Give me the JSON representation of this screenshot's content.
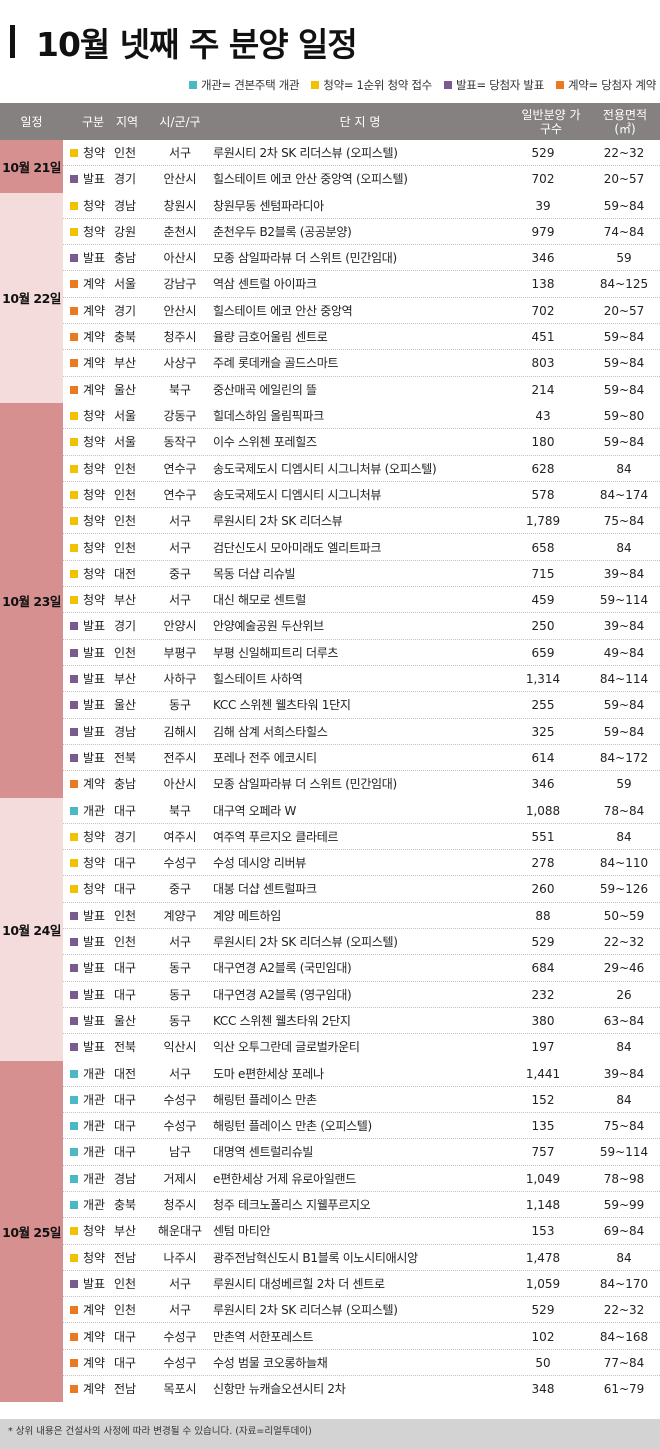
{
  "title": "10월 넷째 주 분양 일정",
  "legend": [
    {
      "label": "개관= 견본주택 개관",
      "color": "#4bb8c4"
    },
    {
      "label": "청약= 1순위 청약 접수",
      "color": "#f2c200"
    },
    {
      "label": "발표= 당첨자 발표",
      "color": "#7b5a8e"
    },
    {
      "label": "계약= 당첨자 계약",
      "color": "#ea7a1f"
    }
  ],
  "columns": {
    "date": "일정",
    "type": "구분",
    "region": "지역",
    "city": "시/군/구",
    "name": "단 지 명",
    "units": "일반분양 가구수",
    "area": "전용면적 (㎡)"
  },
  "type_colors": {
    "개관": "#4bb8c4",
    "청약": "#f2c200",
    "발표": "#7b5a8e",
    "계약": "#ea7a1f"
  },
  "groups": [
    {
      "date": "10월 21일",
      "bg": "#d79090",
      "rows": [
        {
          "type": "청약",
          "region": "인천",
          "city": "서구",
          "name": "루원시티 2차 SK 리더스뷰 (오피스텔)",
          "units": "529",
          "area": "22~32"
        },
        {
          "type": "발표",
          "region": "경기",
          "city": "안산시",
          "name": "힐스테이트 에코 안산 중앙역 (오피스텔)",
          "units": "702",
          "area": "20~57"
        }
      ]
    },
    {
      "date": "10월 22일",
      "bg": "#f4dcdc",
      "rows": [
        {
          "type": "청약",
          "region": "경남",
          "city": "창원시",
          "name": "창원무동 센텀파라디아",
          "units": "39",
          "area": "59~84"
        },
        {
          "type": "청약",
          "region": "강원",
          "city": "춘천시",
          "name": "춘천우두 B2블록 (공공분양)",
          "units": "979",
          "area": "74~84"
        },
        {
          "type": "발표",
          "region": "충남",
          "city": "아산시",
          "name": "모종 삼일파라뷰 더 스위트 (민간임대)",
          "units": "346",
          "area": "59"
        },
        {
          "type": "계약",
          "region": "서울",
          "city": "강남구",
          "name": "역삼 센트럴 아이파크",
          "units": "138",
          "area": "84~125"
        },
        {
          "type": "계약",
          "region": "경기",
          "city": "안산시",
          "name": "힐스테이트 에코 안산 중앙역",
          "units": "702",
          "area": "20~57"
        },
        {
          "type": "계약",
          "region": "충북",
          "city": "청주시",
          "name": "율량 금호어울림 센트로",
          "units": "451",
          "area": "59~84"
        },
        {
          "type": "계약",
          "region": "부산",
          "city": "사상구",
          "name": "주례 롯데캐슬 골드스마트",
          "units": "803",
          "area": "59~84"
        },
        {
          "type": "계약",
          "region": "울산",
          "city": "북구",
          "name": "중산매곡 에일린의 뜰",
          "units": "214",
          "area": "59~84"
        }
      ]
    },
    {
      "date": "10월 23일",
      "bg": "#d79090",
      "rows": [
        {
          "type": "청약",
          "region": "서울",
          "city": "강동구",
          "name": "힐데스하임 올림픽파크",
          "units": "43",
          "area": "59~80"
        },
        {
          "type": "청약",
          "region": "서울",
          "city": "동작구",
          "name": "이수 스위첸 포레힐즈",
          "units": "180",
          "area": "59~84"
        },
        {
          "type": "청약",
          "region": "인천",
          "city": "연수구",
          "name": "송도국제도시 디엠시티 시그니처뷰 (오피스텔)",
          "units": "628",
          "area": "84"
        },
        {
          "type": "청약",
          "region": "인천",
          "city": "연수구",
          "name": "송도국제도시 디엠시티 시그니처뷰",
          "units": "578",
          "area": "84~174"
        },
        {
          "type": "청약",
          "region": "인천",
          "city": "서구",
          "name": "루원시티 2차 SK 리더스뷰",
          "units": "1,789",
          "area": "75~84"
        },
        {
          "type": "청약",
          "region": "인천",
          "city": "서구",
          "name": "검단신도시 모아미래도 엘리트파크",
          "units": "658",
          "area": "84"
        },
        {
          "type": "청약",
          "region": "대전",
          "city": "중구",
          "name": "목동 더샵 리슈빌",
          "units": "715",
          "area": "39~84"
        },
        {
          "type": "청약",
          "region": "부산",
          "city": "서구",
          "name": "대신 해모로 센트럴",
          "units": "459",
          "area": "59~114"
        },
        {
          "type": "발표",
          "region": "경기",
          "city": "안양시",
          "name": "안양예술공원 두산위브",
          "units": "250",
          "area": "39~84"
        },
        {
          "type": "발표",
          "region": "인천",
          "city": "부평구",
          "name": "부평 신일해피트리 더루츠",
          "units": "659",
          "area": "49~84"
        },
        {
          "type": "발표",
          "region": "부산",
          "city": "사하구",
          "name": "힐스테이트 사하역",
          "units": "1,314",
          "area": "84~114"
        },
        {
          "type": "발표",
          "region": "울산",
          "city": "동구",
          "name": "KCC 스위첸 웰츠타워 1단지",
          "units": "255",
          "area": "59~84"
        },
        {
          "type": "발표",
          "region": "경남",
          "city": "김해시",
          "name": "김해 삼계 서희스타힐스",
          "units": "325",
          "area": "59~84"
        },
        {
          "type": "발표",
          "region": "전북",
          "city": "전주시",
          "name": "포레나 전주 에코시티",
          "units": "614",
          "area": "84~172"
        },
        {
          "type": "계약",
          "region": "충남",
          "city": "아산시",
          "name": "모종 삼일파라뷰 더 스위트 (민간임대)",
          "units": "346",
          "area": "59"
        }
      ]
    },
    {
      "date": "10월 24일",
      "bg": "#f4dcdc",
      "rows": [
        {
          "type": "개관",
          "region": "대구",
          "city": "북구",
          "name": "대구역 오페라 W",
          "units": "1,088",
          "area": "78~84"
        },
        {
          "type": "청약",
          "region": "경기",
          "city": "여주시",
          "name": "여주역 푸르지오 클라테르",
          "units": "551",
          "area": "84"
        },
        {
          "type": "청약",
          "region": "대구",
          "city": "수성구",
          "name": "수성 데시앙 리버뷰",
          "units": "278",
          "area": "84~110"
        },
        {
          "type": "청약",
          "region": "대구",
          "city": "중구",
          "name": "대봉 더샵 센트럴파크",
          "units": "260",
          "area": "59~126"
        },
        {
          "type": "발표",
          "region": "인천",
          "city": "계양구",
          "name": "계양 메트하임",
          "units": "88",
          "area": "50~59"
        },
        {
          "type": "발표",
          "region": "인천",
          "city": "서구",
          "name": "루원시티 2차 SK 리더스뷰 (오피스텔)",
          "units": "529",
          "area": "22~32"
        },
        {
          "type": "발표",
          "region": "대구",
          "city": "동구",
          "name": "대구연경 A2블록 (국민임대)",
          "units": "684",
          "area": "29~46"
        },
        {
          "type": "발표",
          "region": "대구",
          "city": "동구",
          "name": "대구연경 A2블록 (영구임대)",
          "units": "232",
          "area": "26"
        },
        {
          "type": "발표",
          "region": "울산",
          "city": "동구",
          "name": "KCC 스위첸 웰츠타워 2단지",
          "units": "380",
          "area": "63~84"
        },
        {
          "type": "발표",
          "region": "전북",
          "city": "익산시",
          "name": "익산 오투그란데 글로벌카운티",
          "units": "197",
          "area": "84"
        }
      ]
    },
    {
      "date": "10월 25일",
      "bg": "#d79090",
      "rows": [
        {
          "type": "개관",
          "region": "대전",
          "city": "서구",
          "name": "도마 e편한세상 포레나",
          "units": "1,441",
          "area": "39~84"
        },
        {
          "type": "개관",
          "region": "대구",
          "city": "수성구",
          "name": "해링턴 플레이스 만촌",
          "units": "152",
          "area": "84"
        },
        {
          "type": "개관",
          "region": "대구",
          "city": "수성구",
          "name": "해링턴 플레이스 만촌 (오피스텔)",
          "units": "135",
          "area": "75~84"
        },
        {
          "type": "개관",
          "region": "대구",
          "city": "남구",
          "name": "대명역 센트럴리슈빌",
          "units": "757",
          "area": "59~114"
        },
        {
          "type": "개관",
          "region": "경남",
          "city": "거제시",
          "name": "e편한세상 거제 유로아일랜드",
          "units": "1,049",
          "area": "78~98"
        },
        {
          "type": "개관",
          "region": "충북",
          "city": "청주시",
          "name": "청주 테크노폴리스 지웰푸르지오",
          "units": "1,148",
          "area": "59~99"
        },
        {
          "type": "청약",
          "region": "부산",
          "city": "해운대구",
          "name": "센텀 마티안",
          "units": "153",
          "area": "69~84"
        },
        {
          "type": "청약",
          "region": "전남",
          "city": "나주시",
          "name": "광주전남혁신도시 B1블록 이노시티애시앙",
          "units": "1,478",
          "area": "84"
        },
        {
          "type": "발표",
          "region": "인천",
          "city": "서구",
          "name": "루원시티 대성베르힐 2차 더 센트로",
          "units": "1,059",
          "area": "84~170"
        },
        {
          "type": "계약",
          "region": "인천",
          "city": "서구",
          "name": "루원시티 2차 SK 리더스뷰 (오피스텔)",
          "units": "529",
          "area": "22~32"
        },
        {
          "type": "계약",
          "region": "대구",
          "city": "수성구",
          "name": "만촌역 서한포레스트",
          "units": "102",
          "area": "84~168"
        },
        {
          "type": "계약",
          "region": "대구",
          "city": "수성구",
          "name": "수성 범물 코오롱하늘채",
          "units": "50",
          "area": "77~84"
        },
        {
          "type": "계약",
          "region": "전남",
          "city": "목포시",
          "name": "신항만 뉴캐슬오션시티 2차",
          "units": "348",
          "area": "61~79"
        }
      ]
    }
  ],
  "footer": "* 상위 내용은 건설사의 사정에 따라 변경될 수 있습니다. (자료=리얼투데이)"
}
